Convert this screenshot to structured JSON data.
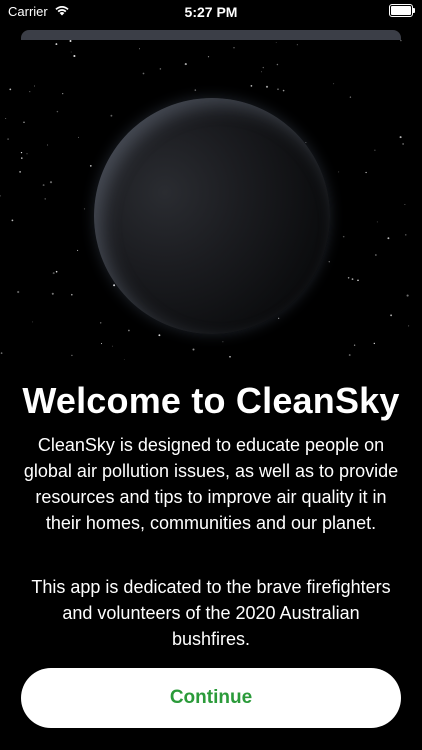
{
  "status_bar": {
    "carrier": "Carrier",
    "time": "5:27 PM",
    "wifi_icon": "wifi-icon",
    "battery_icon": "battery-icon"
  },
  "welcome": {
    "title": "Welcome to CleanSky",
    "description": "CleanSky is designed to educate people on global air pollution issues, as well as to provide resources and tips to improve air quality it in their homes, communities and our planet.",
    "dedication": "This app is dedicated to the brave firefighters and volunteers of the 2020 Australian bushfires.",
    "continue_label": "Continue"
  },
  "colors": {
    "background": "#000000",
    "button_background": "#ffffff",
    "button_text": "#2b9b3a",
    "sheet_edge": "#3b3e47"
  }
}
